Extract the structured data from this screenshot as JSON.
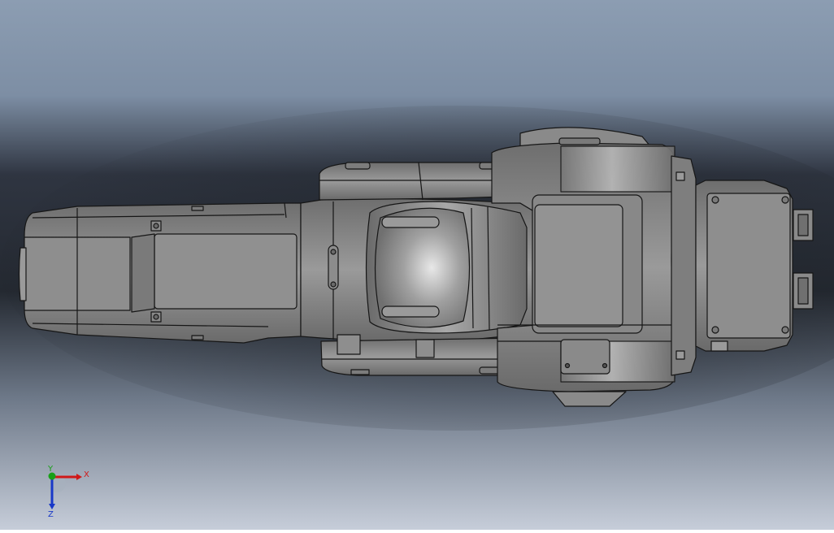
{
  "viewport": {
    "background_top": "#8c9cb0",
    "background_mid": "#2e3440",
    "background_bottom": "#c4ccd8",
    "model_color": "#8a8a8a",
    "edge_color": "#1a1a1a"
  },
  "triad": {
    "x_label": "X",
    "y_label": "Y",
    "z_label": "Z",
    "x_color": "#d01818",
    "y_color": "#18a018",
    "z_color": "#1838c8"
  }
}
